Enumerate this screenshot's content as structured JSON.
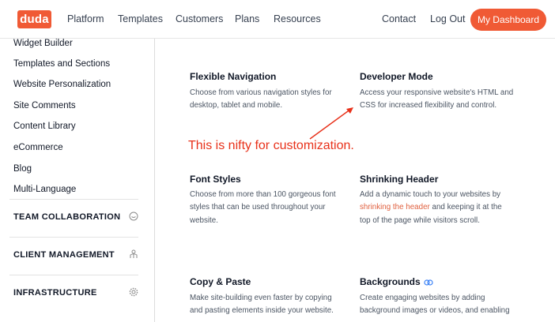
{
  "header": {
    "logo": "duda",
    "nav": [
      "Platform",
      "Templates",
      "Customers",
      "Plans",
      "Resources"
    ],
    "contact": "Contact",
    "logout": "Log Out",
    "dashboard": "My Dashboard"
  },
  "sidebar": {
    "links": [
      "Widget Builder",
      "Templates and Sections",
      "Website Personalization",
      "Site Comments",
      "Content Library",
      "eCommerce",
      "Blog",
      "Multi-Language"
    ],
    "sections": [
      {
        "label": "TEAM COLLABORATION",
        "icon": "chat-icon"
      },
      {
        "label": "CLIENT MANAGEMENT",
        "icon": "client-icon"
      },
      {
        "label": "INFRASTRUCTURE",
        "icon": "gear-icon"
      }
    ]
  },
  "features": {
    "flexible_navigation": {
      "title": "Flexible Navigation",
      "lines": [
        "Choose from various navigation styles for",
        "desktop, tablet and mobile."
      ]
    },
    "developer_mode": {
      "title": "Developer Mode",
      "lines": [
        "Access your responsive website's HTML and",
        "CSS for increased flexibility and control."
      ]
    },
    "font_styles": {
      "title": "Font Styles",
      "lines": [
        "Choose from more than 100 gorgeous font",
        "styles that can be used throughout your",
        "website."
      ]
    },
    "shrinking_header": {
      "title": "Shrinking Header",
      "line1": "Add a dynamic touch to your websites by",
      "link": "shrinking the header",
      "line2_rest": " and keeping it at the",
      "line3": "top of the page while visitors scroll."
    },
    "copy_paste": {
      "title": "Copy & Paste",
      "lines": [
        "Make site-building even faster by copying",
        "and pasting elements inside your website."
      ]
    },
    "backgrounds": {
      "title": "Backgrounds",
      "icon": "link-icon",
      "lines": [
        "Create engaging websites by adding",
        "background images or videos, and enabling"
      ]
    }
  },
  "annotation": "This is nifty for customization.",
  "colors": {
    "brand": "#f05a35",
    "annotation": "#e8311a",
    "link": "#e0603f"
  }
}
